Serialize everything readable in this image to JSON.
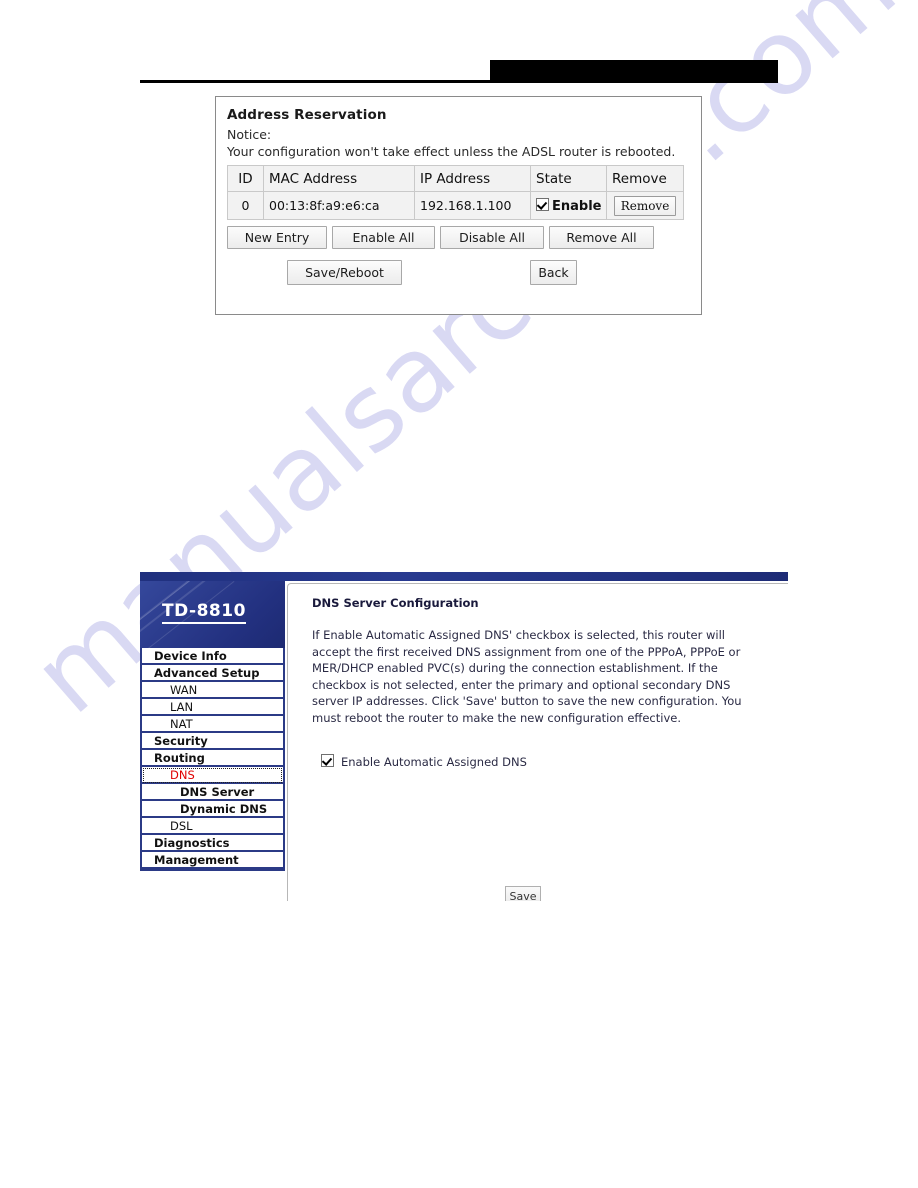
{
  "watermark": {
    "text": "manualsarchive.com"
  },
  "header": {
    "rule": "horizontal-rule",
    "redacted_title": ""
  },
  "figure_address_reservation": {
    "title": "Address Reservation",
    "notice_label": "Notice:",
    "notice_text": "Your configuration won't take effect unless the ADSL router is rebooted.",
    "table": {
      "columns": [
        "ID",
        "MAC Address",
        "IP Address",
        "State",
        "Remove"
      ],
      "rows": [
        {
          "id": "0",
          "mac": "00:13:8f:a9:e6:ca",
          "ip": "192.168.1.100",
          "state_checked": true,
          "state_label": "Enable",
          "remove_label": "Remove"
        }
      ]
    },
    "buttons": {
      "new_entry": "New Entry",
      "enable_all": "Enable All",
      "disable_all": "Disable All",
      "remove_all": "Remove All",
      "save_reboot": "Save/Reboot",
      "back": "Back"
    }
  },
  "figure_router_ui": {
    "brand": {
      "model": "TD-8810"
    },
    "menu": [
      {
        "label": "Device Info",
        "level": 1,
        "selected": false
      },
      {
        "label": "Advanced Setup",
        "level": 1,
        "selected": false
      },
      {
        "label": "WAN",
        "level": 2,
        "selected": false
      },
      {
        "label": "LAN",
        "level": 2,
        "selected": false
      },
      {
        "label": "NAT",
        "level": 2,
        "selected": false
      },
      {
        "label": "Security",
        "level": 1,
        "selected": false
      },
      {
        "label": "Routing",
        "level": 1,
        "selected": false
      },
      {
        "label": "DNS",
        "level": 2,
        "selected": true
      },
      {
        "label": "DNS Server",
        "level": 3,
        "selected": false
      },
      {
        "label": "Dynamic DNS",
        "level": 3,
        "selected": false
      },
      {
        "label": "DSL",
        "level": 2,
        "selected": false
      },
      {
        "label": "Diagnostics",
        "level": 1,
        "selected": false
      },
      {
        "label": "Management",
        "level": 1,
        "selected": false
      }
    ],
    "content": {
      "title": "DNS Server Configuration",
      "paragraph": "If Enable Automatic Assigned DNS' checkbox is selected, this router will accept the first received DNS assignment from one of the PPPoA, PPPoE or MER/DHCP enabled PVC(s) during the connection establishment. If the checkbox is not selected, enter the primary and optional secondary DNS server IP addresses. Click 'Save' button to save the new configuration. You must reboot the router to make the new configuration effective.",
      "checkbox": {
        "label": "Enable Automatic Assigned DNS",
        "checked": true
      },
      "save_button": "Save"
    }
  },
  "colors": {
    "brand_blue": "#2b3a86",
    "selected_menu_text": "#e00000",
    "watermark": "#d9d9f3",
    "redaction": "#000000"
  }
}
